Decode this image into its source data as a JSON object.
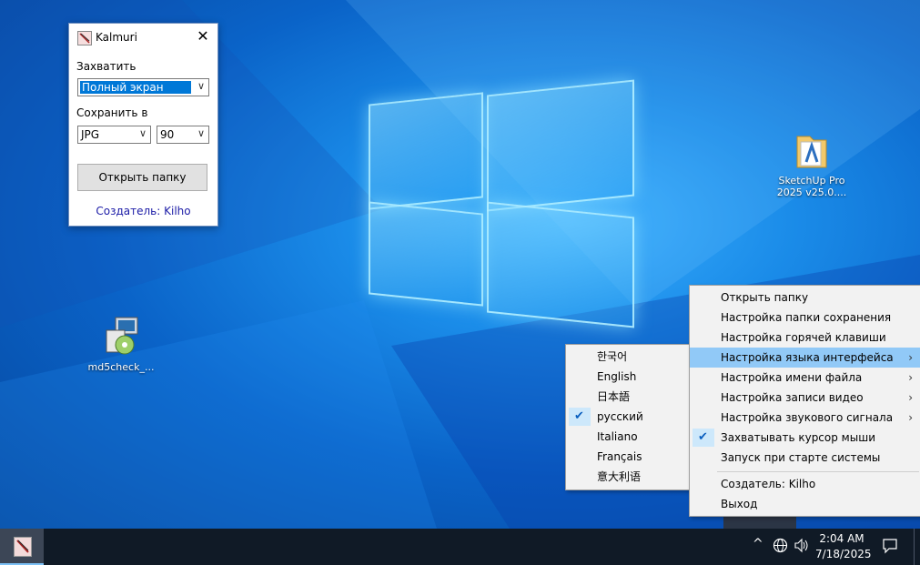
{
  "kalmuri_window": {
    "title": "Kalmuri",
    "capture_label": "Захватить",
    "capture_value": "Полный экран",
    "save_label": "Сохранить в",
    "format_value": "JPG",
    "quality_value": "90",
    "open_folder_button": "Открыть папку",
    "creator_link": "Создатель: Kilho"
  },
  "desktop_icons": [
    {
      "label": "md5check_...",
      "icon": "installer-icon"
    },
    {
      "label": "SketchUp Pro 2025 v25.0....",
      "icon": "folder-icon"
    }
  ],
  "main_menu": {
    "items": [
      {
        "label": "Открыть папку"
      },
      {
        "label": "Настройка папки сохранения"
      },
      {
        "label": "Настройка горячей клавиши"
      },
      {
        "label": "Настройка языка интерфейса",
        "submenu": true,
        "highlighted": true
      },
      {
        "label": "Настройка имени файла",
        "submenu": true
      },
      {
        "label": "Настройка записи видео",
        "submenu": true
      },
      {
        "label": "Настройка звукового сигнала",
        "submenu": true
      },
      {
        "label": "Захватывать курсор мыши",
        "checked": true
      },
      {
        "label": "Запуск при старте системы"
      },
      {
        "label": "Создатель: Kilho"
      },
      {
        "label": "Выход"
      }
    ]
  },
  "language_menu": {
    "items": [
      {
        "label": "한국어"
      },
      {
        "label": "English"
      },
      {
        "label": "日本語"
      },
      {
        "label": "русский",
        "checked": true
      },
      {
        "label": "Italiano"
      },
      {
        "label": "Français"
      },
      {
        "label": "意大利语"
      }
    ]
  },
  "taskbar": {
    "time": "2:04 AM",
    "date": "7/18/2025",
    "chevron": "^"
  },
  "colors": {
    "highlight": "#91c9f7",
    "selection": "#0078d7",
    "taskbar": "#101a26"
  }
}
